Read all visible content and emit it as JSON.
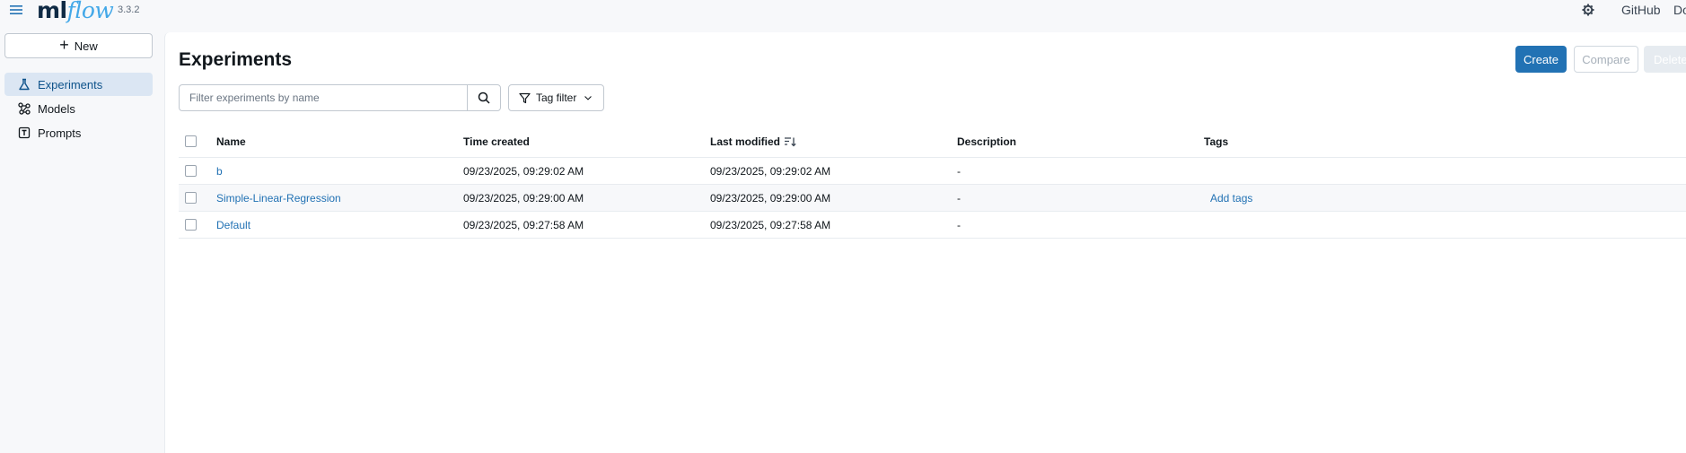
{
  "header": {
    "logo_ml": "ml",
    "logo_flow": "flow",
    "version": "3.3.2",
    "github_label": "GitHub",
    "docs_label": "Docs"
  },
  "sidebar": {
    "new_label": "New",
    "items": [
      {
        "label": "Experiments",
        "icon": "beaker-icon",
        "active": true
      },
      {
        "label": "Models",
        "icon": "models-icon",
        "active": false
      },
      {
        "label": "Prompts",
        "icon": "prompt-icon",
        "active": false
      }
    ]
  },
  "main": {
    "title": "Experiments",
    "create_label": "Create",
    "compare_label": "Compare",
    "delete_label": "Delete",
    "search_placeholder": "Filter experiments by name",
    "tag_filter_label": "Tag filter"
  },
  "table": {
    "columns": {
      "name": "Name",
      "time_created": "Time created",
      "last_modified": "Last modified",
      "description": "Description",
      "tags": "Tags"
    },
    "rows": [
      {
        "name": "b",
        "time_created": "09/23/2025, 09:29:02 AM",
        "last_modified": "09/23/2025, 09:29:02 AM",
        "description": "-",
        "tags": ""
      },
      {
        "name": "Simple-Linear-Regression",
        "time_created": "09/23/2025, 09:29:00 AM",
        "last_modified": "09/23/2025, 09:29:00 AM",
        "description": "-",
        "tags": "Add tags"
      },
      {
        "name": "Default",
        "time_created": "09/23/2025, 09:27:58 AM",
        "last_modified": "09/23/2025, 09:27:58 AM",
        "description": "-",
        "tags": ""
      }
    ]
  },
  "colors": {
    "primary": "#2272b4",
    "active_nav_bg": "#dbe6f3",
    "background": "#f7f8fa"
  }
}
